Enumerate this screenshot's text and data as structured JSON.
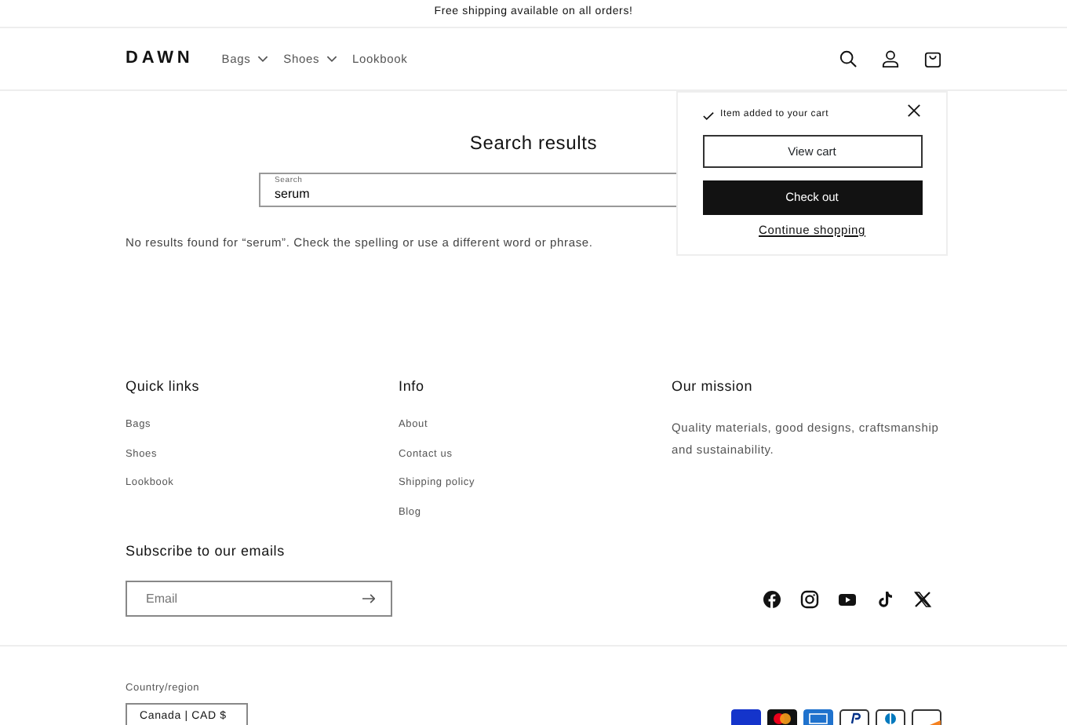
{
  "announcement": "Free shipping available on all orders!",
  "header": {
    "logo": "DAWN",
    "nav": [
      {
        "label": "Bags",
        "dropdown": true
      },
      {
        "label": "Shoes",
        "dropdown": true
      },
      {
        "label": "Lookbook",
        "dropdown": false
      }
    ]
  },
  "main": {
    "title": "Search results",
    "search": {
      "label": "Search",
      "value": "serum"
    },
    "message": "No results found for “serum”. Check the spelling or use a different word or phrase."
  },
  "cart_popup": {
    "notice": "Item added to your cart",
    "view_cart": "View cart",
    "checkout": "Check out",
    "continue": "Continue shopping"
  },
  "footer": {
    "columns": [
      {
        "heading": "Quick links",
        "links": [
          "Bags",
          "Shoes",
          "Lookbook"
        ]
      },
      {
        "heading": "Info",
        "links": [
          "About",
          "Contact us",
          "Shipping policy",
          "Blog"
        ]
      },
      {
        "heading": "Our mission",
        "text": "Quality materials, good designs, craftsmanship and sustainability."
      }
    ],
    "subscribe": {
      "heading": "Subscribe to our emails",
      "placeholder": "Email"
    },
    "country": {
      "label": "Country/region",
      "value": "Canada | CAD $"
    }
  }
}
